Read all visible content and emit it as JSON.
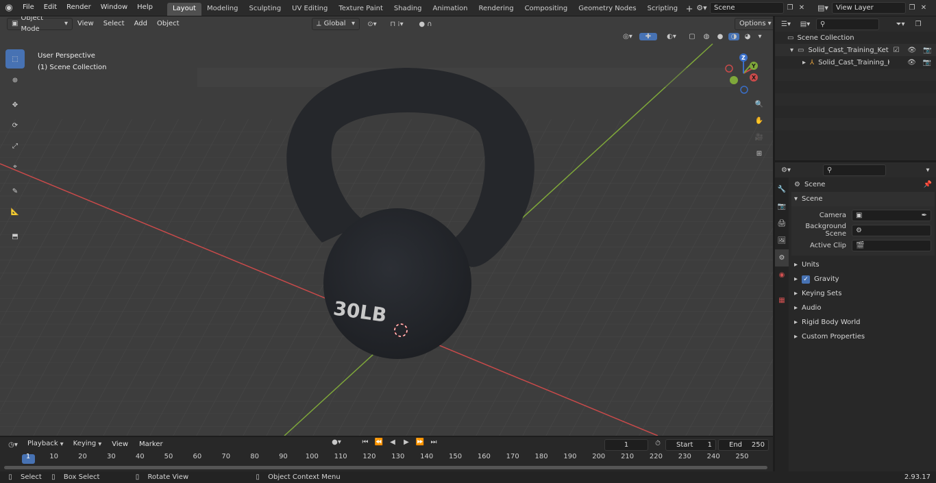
{
  "topbar": {
    "menus": [
      "File",
      "Edit",
      "Render",
      "Window",
      "Help"
    ],
    "workspaces": [
      "Layout",
      "Modeling",
      "Sculpting",
      "UV Editing",
      "Texture Paint",
      "Shading",
      "Animation",
      "Rendering",
      "Compositing",
      "Geometry Nodes",
      "Scripting"
    ],
    "active_workspace": "Layout",
    "scene_name": "Scene",
    "view_layer": "View Layer"
  },
  "viewport": {
    "mode": "Object Mode",
    "menus": [
      "View",
      "Select",
      "Add",
      "Object"
    ],
    "transform_orientation": "Global",
    "options_label": "Options",
    "overlay_title": "User Perspective",
    "overlay_collection": "(1) Scene Collection",
    "object_text": "30LB",
    "gizmo_x": "X",
    "gizmo_y": "Y",
    "gizmo_z": "Z"
  },
  "outliner": {
    "root": "Scene Collection",
    "items": [
      {
        "name": "Solid_Cast_Training_Kettlebel"
      },
      {
        "name": "Solid_Cast_Training_Kettl"
      }
    ]
  },
  "properties": {
    "header": "Scene",
    "panel_title": "Scene",
    "fields": [
      {
        "label": "Camera"
      },
      {
        "label": "Background Scene"
      },
      {
        "label": "Active Clip"
      }
    ],
    "sections": [
      "Units",
      "Gravity",
      "Keying Sets",
      "Audio",
      "Rigid Body World",
      "Custom Properties"
    ]
  },
  "timeline": {
    "menus": [
      "Playback",
      "Keying",
      "View",
      "Marker"
    ],
    "current_frame": "1",
    "start_label": "Start",
    "start_value": "1",
    "end_label": "End",
    "end_value": "250",
    "ticks": [
      "1",
      "10",
      "20",
      "30",
      "40",
      "50",
      "60",
      "70",
      "80",
      "90",
      "100",
      "110",
      "120",
      "130",
      "140",
      "150",
      "160",
      "170",
      "180",
      "190",
      "200",
      "210",
      "220",
      "230",
      "240",
      "250"
    ]
  },
  "statusbar": {
    "select": "Select",
    "box_select": "Box Select",
    "rotate_view": "Rotate View",
    "context_menu": "Object Context Menu",
    "version": "2.93.17"
  },
  "colors": {
    "accent": "#4772b3",
    "x_axis": "#c94a4a",
    "y_axis": "#7fa83a",
    "gizmo_z": "#3a6fc9"
  }
}
